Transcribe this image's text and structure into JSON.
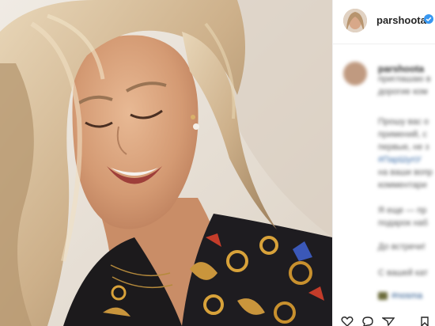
{
  "header": {
    "username": "parshoota",
    "verified": true
  },
  "caption": {
    "username": "parshoota",
    "lines": [
      "приглашаю в",
      "дорогие ком",
      "",
      "Прошу вас о",
      "примений, с",
      "первые, не з",
      "#ПарШупУ",
      "на ваши вопр",
      "комментари",
      "",
      "Я еще — пр",
      "подарок наб",
      "",
      "До встречи!",
      "",
      "С вашей кат",
      "",
      "#nosma"
    ]
  },
  "icons": {
    "verified": "verified-badge-icon",
    "like": "heart-icon",
    "comment": "comment-icon",
    "share": "share-icon",
    "save": "bookmark-icon"
  },
  "colors": {
    "verified": "#3897f0",
    "username": "#262626",
    "link": "#3d6ea8"
  }
}
